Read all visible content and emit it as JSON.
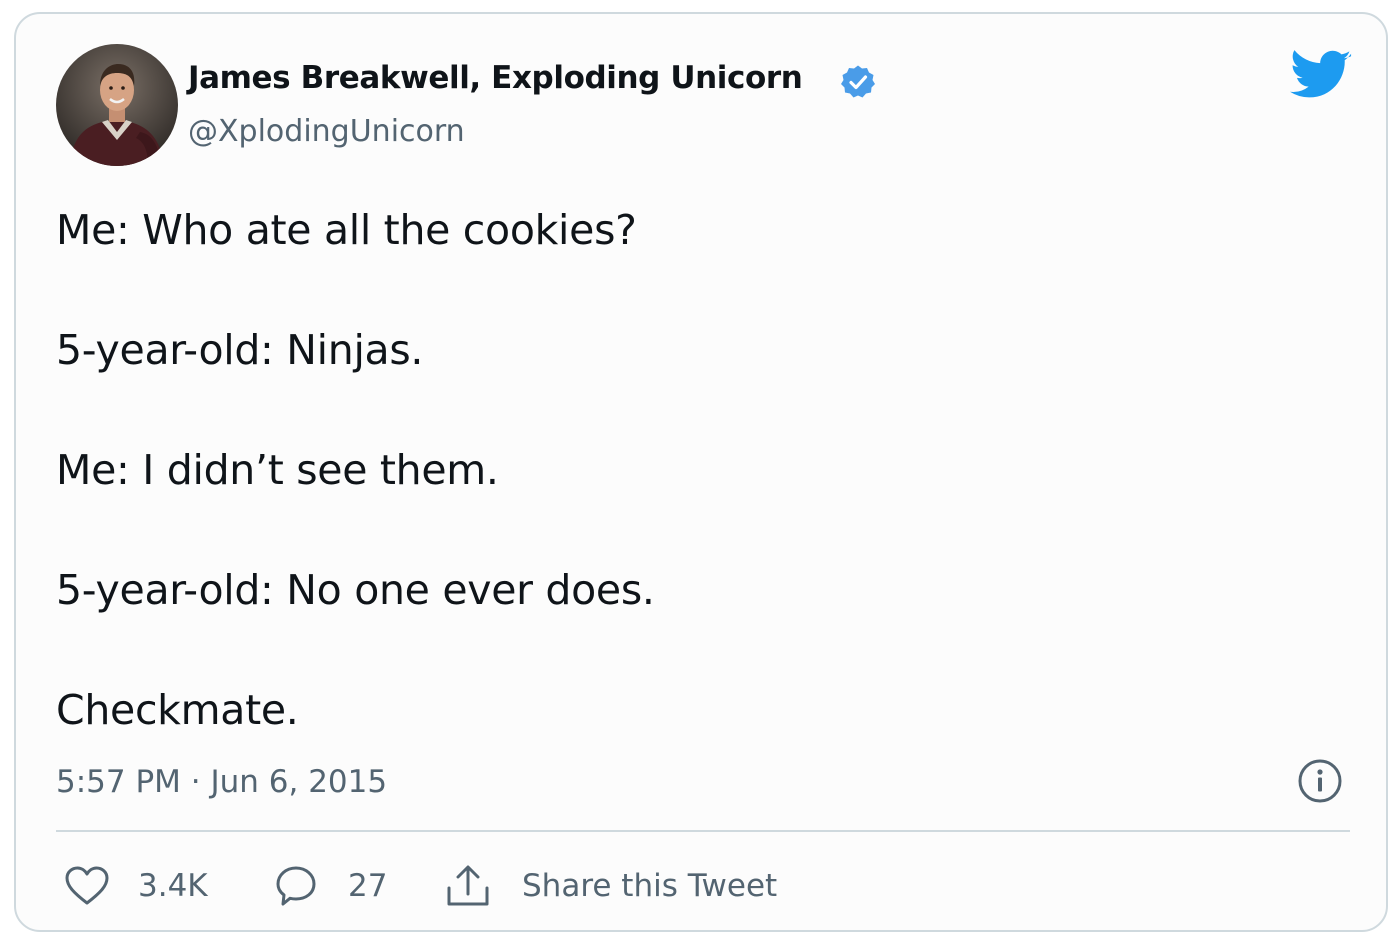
{
  "tweet": {
    "author": {
      "name": "James Breakwell, Exploding Unicorn",
      "handle": "@XplodingUnicorn",
      "verified": true,
      "avatar": "profile-photo"
    },
    "text_lines": [
      "Me: Who ate all the cookies?",
      "5-year-old: Ninjas.",
      "Me: I didn’t see them.",
      "5-year-old: No one ever does.",
      "Checkmate."
    ],
    "timestamp": "5:57 PM · Jun 6, 2015",
    "actions": {
      "likes": "3.4K",
      "replies": "27",
      "share_label": "Share this Tweet"
    }
  },
  "icons": {
    "brand": "twitter-bird-icon",
    "verified": "verified-badge-icon",
    "info": "info-icon",
    "like": "heart-icon",
    "reply": "speech-bubble-icon",
    "share": "share-icon"
  },
  "colors": {
    "twitter_blue": "#1d9bf0",
    "verified_blue": "#4a9ce8",
    "secondary_text": "#536471",
    "primary_text": "#0f1419",
    "border": "#cfd9de",
    "card_background": "#fcfcfc"
  }
}
